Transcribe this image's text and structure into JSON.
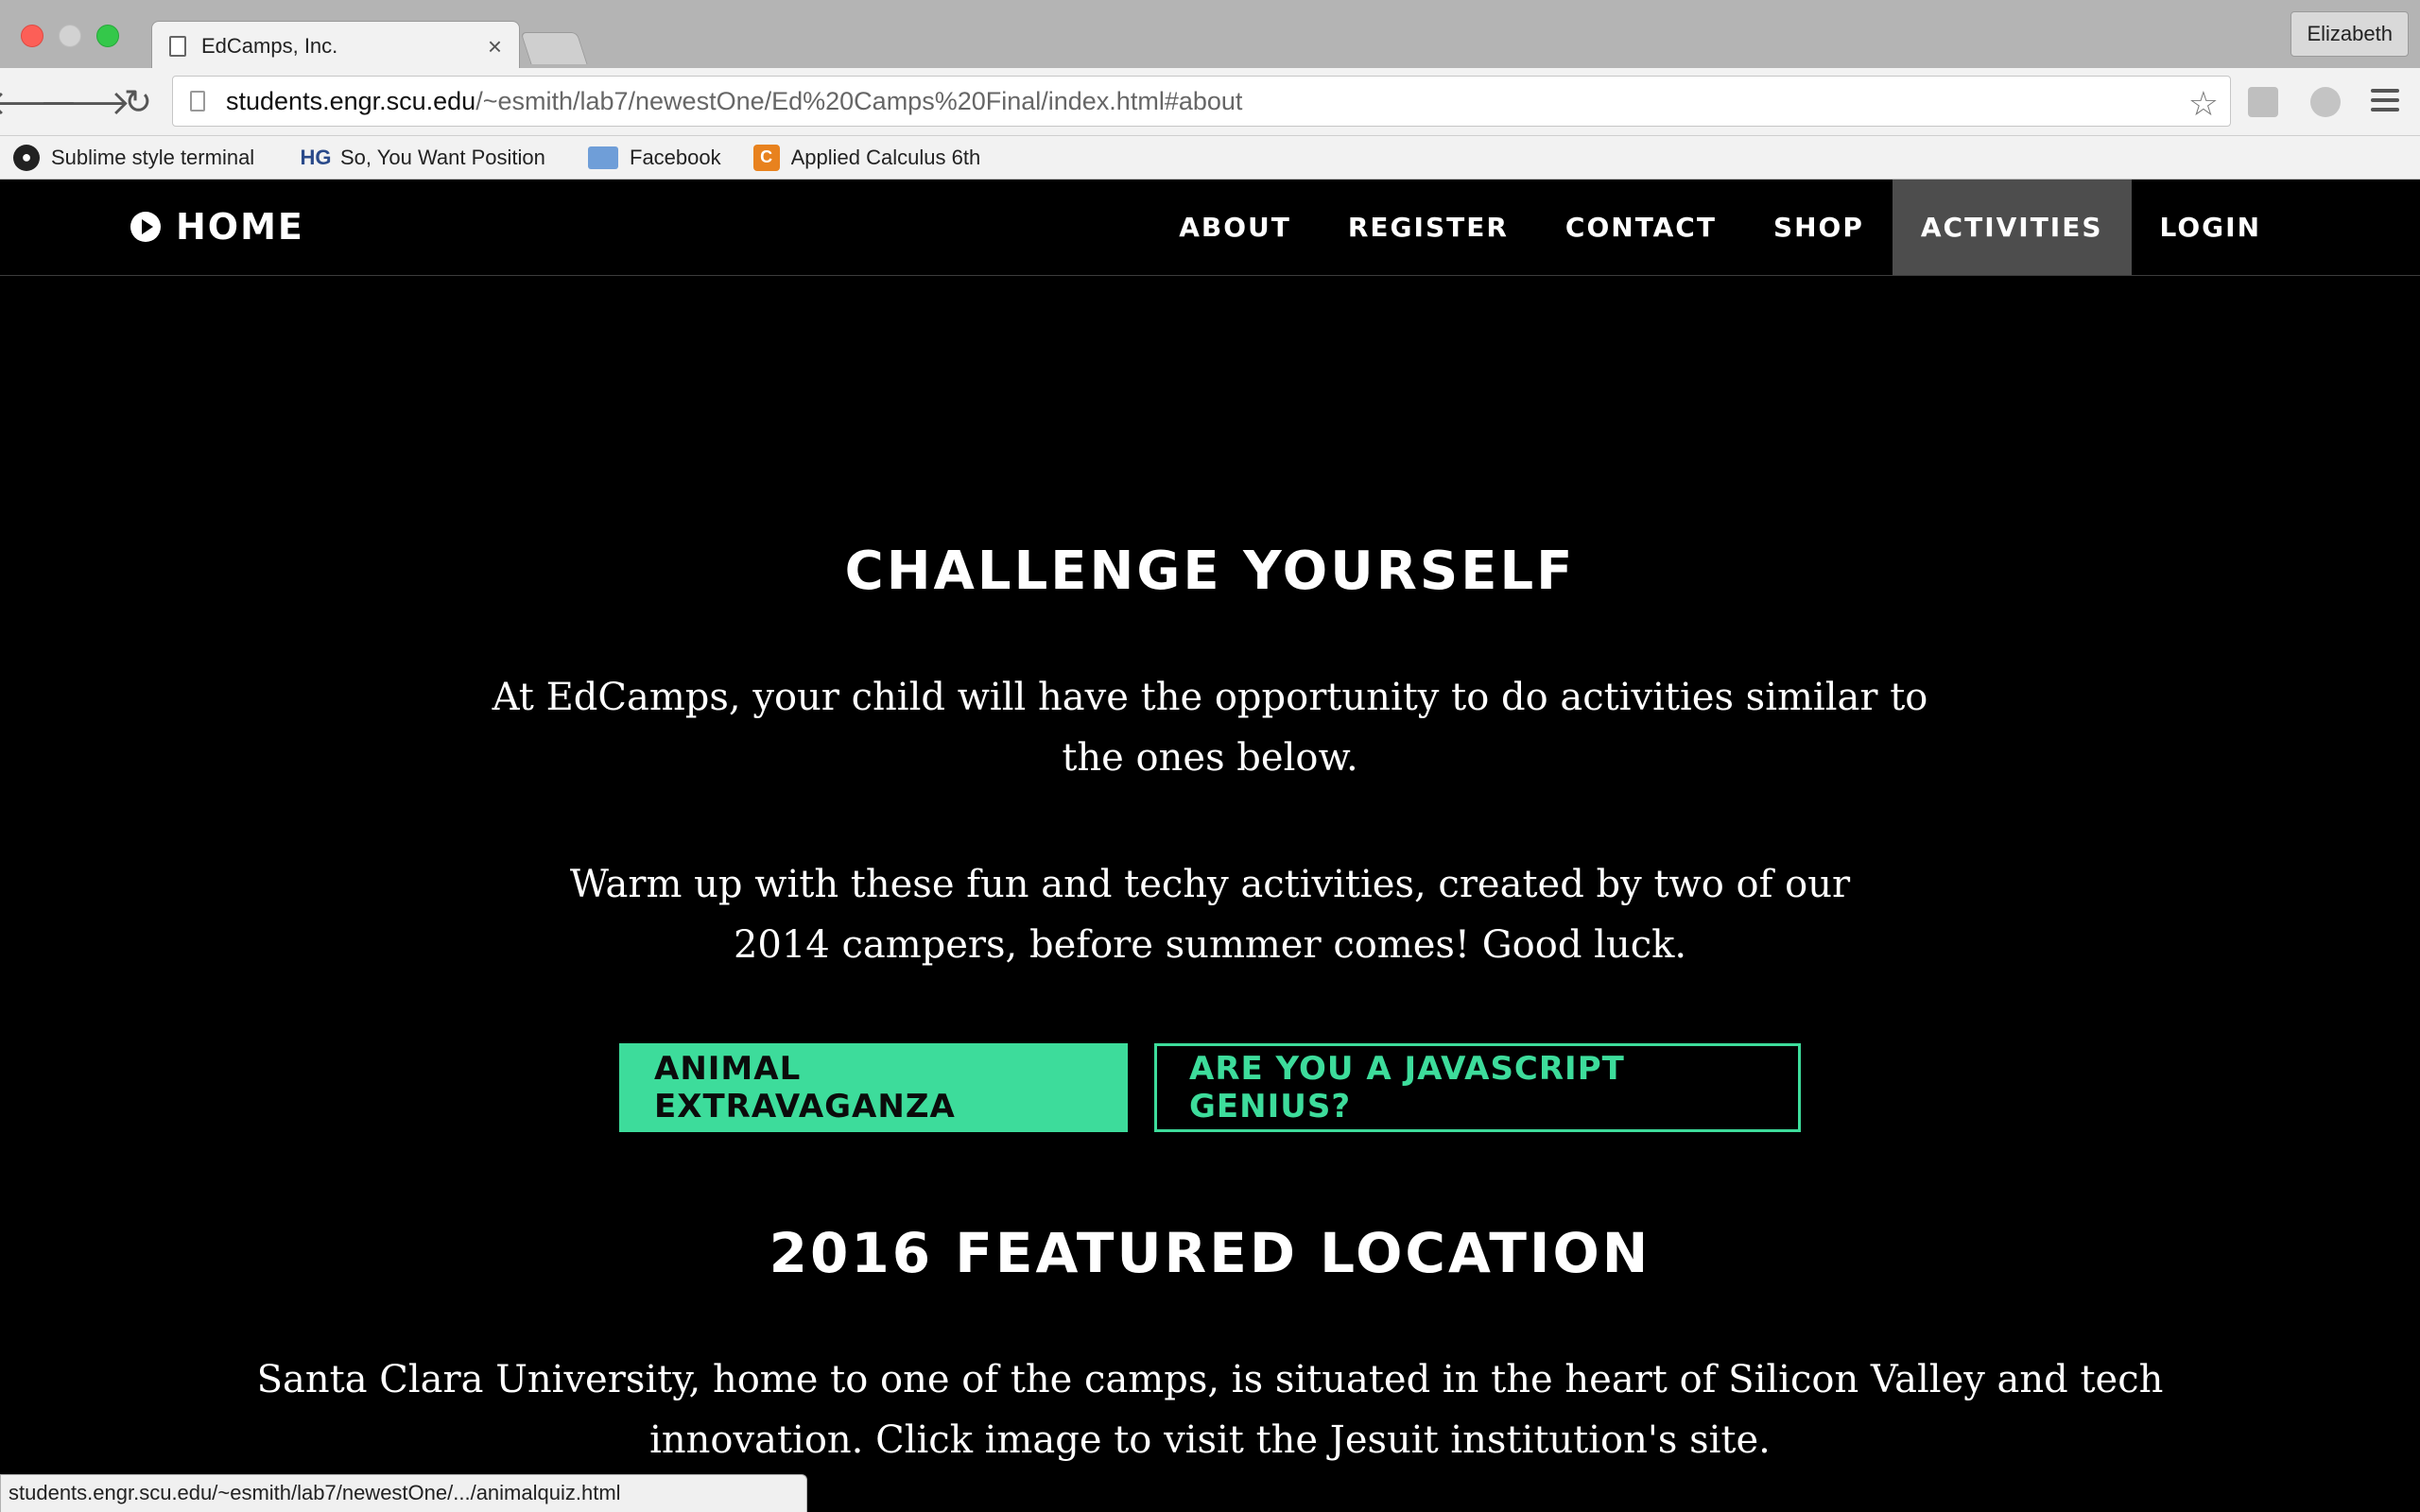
{
  "browser": {
    "tab_title": "EdCamps, Inc.",
    "tab_close": "×",
    "profile_name": "Elizabeth",
    "url_host": "students.engr.scu.edu",
    "url_path": "/~esmith/lab7/newestOne/Ed%20Camps%20Final/index.html#about",
    "bookmarks": [
      {
        "label": "Sublime style terminal",
        "icon": "github-icon"
      },
      {
        "label": "So, You Want Position",
        "icon": "hg-icon",
        "icon_text": "HG"
      },
      {
        "label": "Facebook",
        "icon": "folder-icon"
      },
      {
        "label": "Applied Calculus 6th",
        "icon": "calc-icon",
        "icon_text": "C"
      }
    ],
    "status_url": "students.engr.scu.edu/~esmith/lab7/newestOne/.../animalquiz.html",
    "nav_glyphs": {
      "back": "🡐",
      "forward": "🡒",
      "reload": "↻",
      "star": "☆"
    }
  },
  "site": {
    "home_label": "HOME",
    "nav": [
      {
        "label": "ABOUT",
        "active": false
      },
      {
        "label": "REGISTER",
        "active": false
      },
      {
        "label": "CONTACT",
        "active": false
      },
      {
        "label": "SHOP",
        "active": false
      },
      {
        "label": "ACTIVITIES",
        "active": true
      },
      {
        "label": "LOGIN",
        "active": false
      }
    ],
    "accent_color": "#3ddc9b"
  },
  "content": {
    "heading1": "CHALLENGE YOURSELF",
    "paragraph1": "At EdCamps, your child will have the opportunity to do activities similar to the ones below.",
    "paragraph2": "Warm up with these fun and techy activities, created by two of our 2014 campers, before summer comes! Good luck.",
    "button_primary": "ANIMAL EXTRAVAGANZA",
    "button_secondary": "ARE YOU A JAVASCRIPT GENIUS?",
    "heading2": "2016 FEATURED LOCATION",
    "paragraph3": "Santa Clara University, home to one of the camps, is situated in the heart of Silicon Valley and tech innovation. Click image to visit the Jesuit institution's site."
  }
}
